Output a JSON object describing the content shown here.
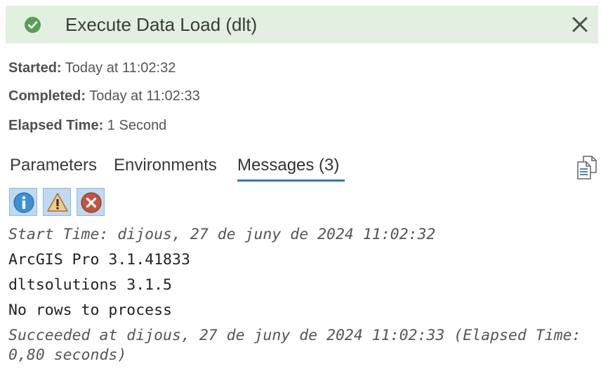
{
  "header": {
    "title": "Execute Data Load (dlt)",
    "status_icon": "check-circle-icon",
    "close_icon": "close-icon",
    "status_color": "#5a9e54",
    "background_color": "#e3efe1"
  },
  "info": {
    "started": {
      "label": "Started:",
      "value": "Today at 11:02:32"
    },
    "completed": {
      "label": "Completed:",
      "value": "Today at 11:02:33"
    },
    "elapsed": {
      "label": "Elapsed Time:",
      "value": "1 Second"
    }
  },
  "tabs": [
    {
      "label": "Parameters",
      "active": false
    },
    {
      "label": "Environments",
      "active": false
    },
    {
      "label": "Messages (3)",
      "active": true
    }
  ],
  "accent_color": "#3a77b5",
  "toolbar": {
    "copy_icon": "copy-icon"
  },
  "filters": [
    {
      "icon": "info-icon",
      "selected": true
    },
    {
      "icon": "warning-icon",
      "selected": true
    },
    {
      "icon": "error-icon",
      "selected": true
    }
  ],
  "messages": [
    {
      "text": "Start Time: dijous, 27 de juny de 2024 11:02:32",
      "style": "italic"
    },
    {
      "text": "ArcGIS Pro 3.1.41833",
      "style": "normal"
    },
    {
      "text": "dltsolutions 3.1.5",
      "style": "normal"
    },
    {
      "text": "No rows to process",
      "style": "normal"
    },
    {
      "text": "Succeeded at dijous, 27 de juny de 2024 11:02:33 (Elapsed Time:",
      "style": "italic"
    },
    {
      "text": "0,80 seconds)",
      "style": "italic"
    }
  ]
}
